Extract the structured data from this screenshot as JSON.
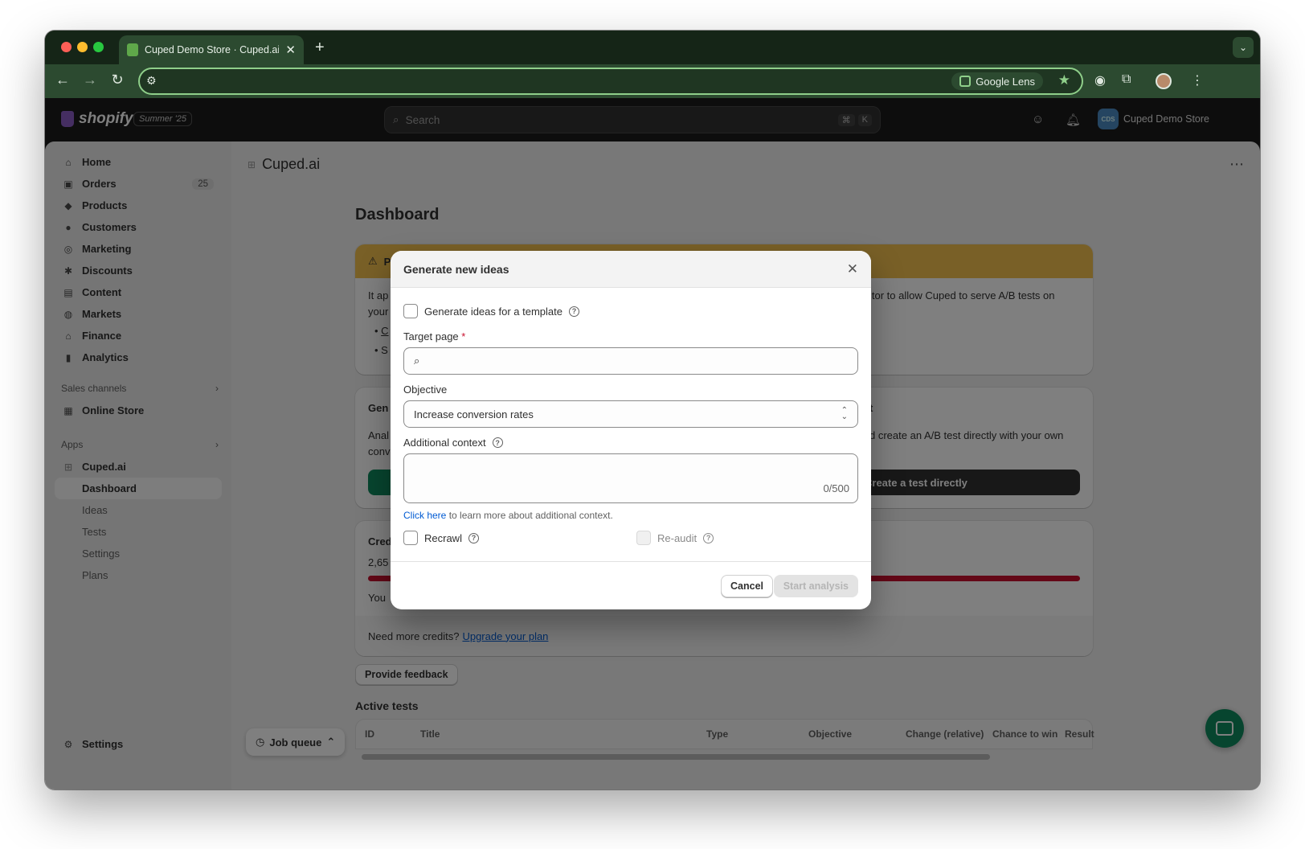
{
  "browser": {
    "tab_title": "Cuped Demo Store · Cuped.ai",
    "new_tab": "+",
    "lens_label": "Google Lens"
  },
  "shopify": {
    "logo": "shopify",
    "edition": "Summer '25",
    "search_placeholder": "Search",
    "search_shortcut": [
      "⌘",
      "K"
    ],
    "store_initials": "CDS",
    "store_name": "Cuped Demo Store"
  },
  "sidebar": {
    "items": [
      {
        "label": "Home",
        "icon": "home-icon"
      },
      {
        "label": "Orders",
        "icon": "orders-icon",
        "count": "25"
      },
      {
        "label": "Products",
        "icon": "tag-icon"
      },
      {
        "label": "Customers",
        "icon": "person-icon"
      },
      {
        "label": "Marketing",
        "icon": "target-icon"
      },
      {
        "label": "Discounts",
        "icon": "discount-icon"
      },
      {
        "label": "Content",
        "icon": "content-icon"
      },
      {
        "label": "Markets",
        "icon": "globe-icon"
      },
      {
        "label": "Finance",
        "icon": "bank-icon"
      },
      {
        "label": "Analytics",
        "icon": "chart-icon"
      }
    ],
    "sales_channels_heading": "Sales channels",
    "online_store": "Online Store",
    "apps_heading": "Apps",
    "app_name": "Cuped.ai",
    "app_subitems": [
      "Dashboard",
      "Ideas",
      "Tests",
      "Settings",
      "Plans"
    ],
    "settings": "Settings"
  },
  "main": {
    "app_title": "Cuped.ai",
    "page_title": "Dashboard",
    "banner_initial": "P",
    "banner_text_1a": "It ap",
    "banner_text_1b": "itor to allow Cuped to serve A/B tests on",
    "banner_text_2": "your",
    "banner_bullet_1": "C",
    "banner_bullet_2": "S",
    "ideas_card_title": "Gen",
    "ideas_card_right_title": "t",
    "ideas_card_text_1": "Anal",
    "ideas_card_text_1b": "d create an A/B test directly with your own",
    "ideas_card_text_2": "conv",
    "create_test_button": "Create a test directly",
    "credits_title": "Cred",
    "credits_value": "2,65",
    "credits_progress": 1.0,
    "credits_text": "You",
    "credits_footer_text": "Need more credits?",
    "credits_footer_link": "Upgrade your plan",
    "feedback_button": "Provide feedback",
    "active_tests_title": "Active tests",
    "table_columns": [
      "ID",
      "Title",
      "Type",
      "Objective",
      "Change (relative)",
      "Chance to win",
      "Result"
    ],
    "job_queue": "Job queue"
  },
  "modal": {
    "title": "Generate new ideas",
    "template_checkbox_label": "Generate ideas for a template",
    "target_page_label": "Target page",
    "required_mark": "*",
    "target_page_value": "",
    "objective_label": "Objective",
    "objective_value": "Increase conversion rates",
    "context_label": "Additional context",
    "context_counter": "0/500",
    "hint_link": "Click here",
    "hint_text": " to learn more about additional context.",
    "recrawl_label": "Recrawl",
    "reaudit_label": "Re-audit",
    "cancel_button": "Cancel",
    "start_button": "Start analysis"
  },
  "colors": {
    "accent_green": "#0f8a5f",
    "warning_banner": "#f2c14e",
    "credits_bar": "#c8102e",
    "link": "#005bd3"
  }
}
